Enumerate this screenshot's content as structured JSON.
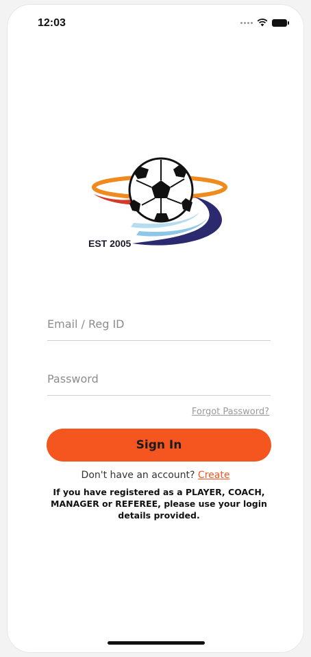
{
  "status_bar": {
    "time": "12:03",
    "icons": [
      "signal-dots-icon",
      "wifi-icon",
      "battery-icon"
    ]
  },
  "logo": {
    "text": "EST 2005",
    "icon": "soccer-ball-logo-icon",
    "colors": {
      "orange_ring": "#ef8a1f",
      "red_swoosh": "#d43a2a",
      "navy_swoosh": "#2c2a6e",
      "light_blue_swoosh": "#8dc6e6"
    }
  },
  "form": {
    "email_placeholder": "Email / Reg ID",
    "password_placeholder": "Password",
    "forgot_password": "Forgot Password?",
    "sign_in_label": "Sign In",
    "account_prompt": "Don't have an account?",
    "create_label": "Create",
    "notice": "If you have registered as a PLAYER, COACH, MANAGER or REFEREE, please use your login details provided."
  },
  "colors": {
    "accent": "#f5551f",
    "background": "#ffffff"
  }
}
